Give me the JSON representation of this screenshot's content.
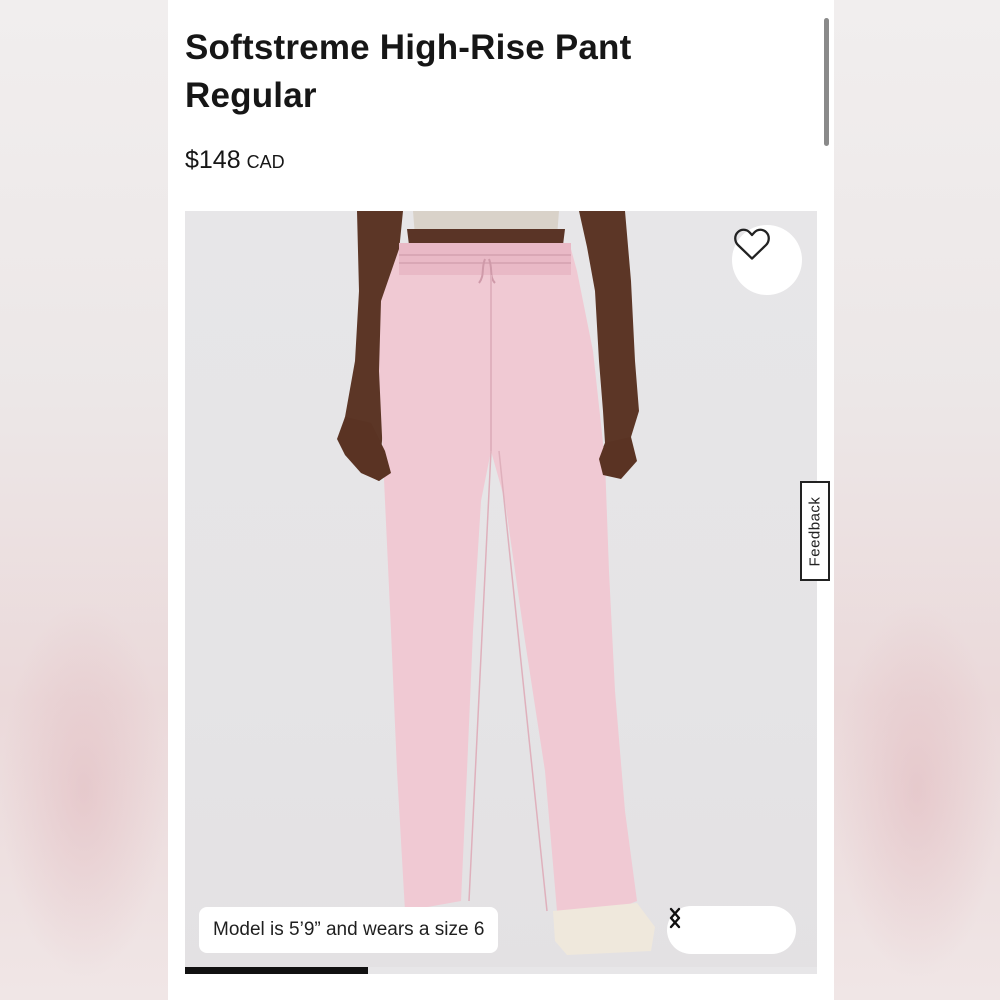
{
  "product": {
    "title": "Softstreme High-Rise Pant Regular",
    "price": "$148",
    "currency": "CAD"
  },
  "gallery": {
    "caption": "Model is 5’9” and wears a size 6",
    "wishlist_icon": "heart-outline-icon",
    "prev_icon": "chevron-left-icon",
    "next_icon": "chevron-right-icon",
    "image_progress": 0.29
  },
  "feedback": {
    "label": "Feedback"
  },
  "colors": {
    "pant": "#efc7d1",
    "background": "#e6e5e7"
  }
}
